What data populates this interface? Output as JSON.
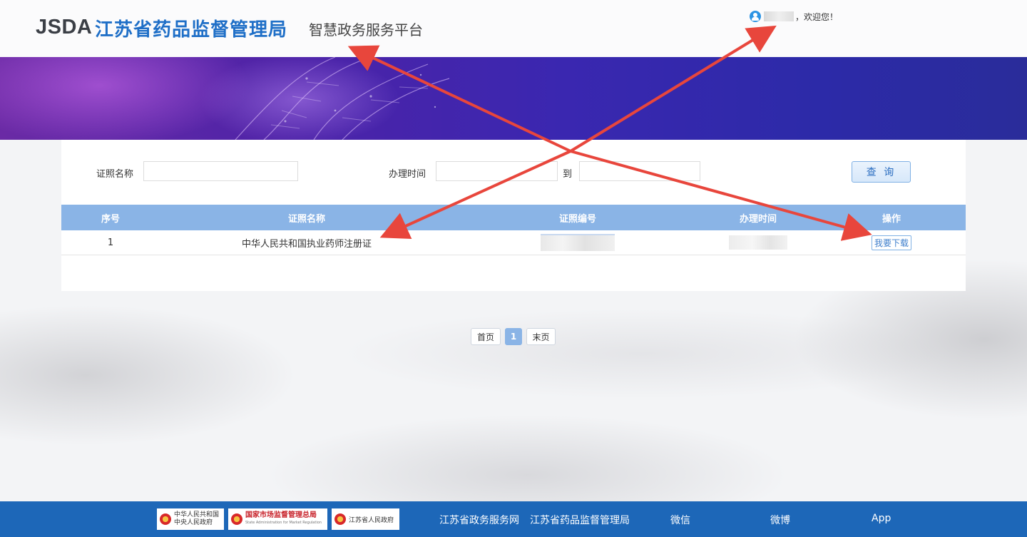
{
  "header": {
    "logo_en": "JSDA",
    "logo_cn": "江苏省药品监督管理局",
    "platform": "智慧政务服务平台",
    "welcome": "，欢迎您！"
  },
  "search": {
    "cert_name_label": "证照名称",
    "cert_name_value": "",
    "time_label": "办理时间",
    "time_from_value": "",
    "to_label": "到",
    "time_to_value": "",
    "query_button": "查 询"
  },
  "table": {
    "columns": [
      "序号",
      "证照名称",
      "证照编号",
      "办理时间",
      "操作"
    ],
    "rows": [
      {
        "index": "1",
        "name": "中华人民共和国执业药师注册证",
        "action": "我要下载"
      }
    ]
  },
  "pagination": {
    "first": "首页",
    "current": "1",
    "last": "末页"
  },
  "footer": {
    "logos": [
      {
        "line1": "中华人民共和国",
        "line2": "中央人民政府"
      },
      {
        "line1": "国家市场监督管理总局",
        "line2": "State Administration for Market Regulation"
      },
      {
        "line1": "江苏省人民政府",
        "line2": ""
      }
    ],
    "links": [
      "江苏省政务服务网",
      "江苏省药品监督管理局",
      "微信",
      "微博",
      "App"
    ]
  },
  "colors": {
    "brand_blue": "#1f6fc7",
    "table_header": "#8ab4e6",
    "footer": "#1d67b8",
    "annotation_red": "#e8463c"
  }
}
